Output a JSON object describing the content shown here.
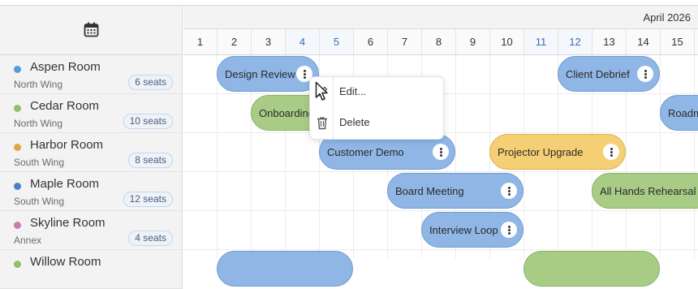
{
  "header": {
    "calendar_icon": "calendar-icon",
    "month": "April 2026",
    "days": [
      "1",
      "2",
      "3",
      "4",
      "5",
      "6",
      "7",
      "8",
      "9",
      "10",
      "11",
      "12",
      "13",
      "14",
      "15"
    ],
    "weekend_days": [
      "4",
      "5",
      "11",
      "12"
    ]
  },
  "resources": [
    {
      "name": "Aspen Room",
      "location": "North Wing",
      "seats": "6 seats",
      "color": "#5b9bd5"
    },
    {
      "name": "Cedar Room",
      "location": "North Wing",
      "seats": "10 seats",
      "color": "#8fc16a"
    },
    {
      "name": "Harbor Room",
      "location": "South Wing",
      "seats": "8 seats",
      "color": "#e0a544"
    },
    {
      "name": "Maple Room",
      "location": "South Wing",
      "seats": "12 seats",
      "color": "#4a82c4"
    },
    {
      "name": "Skyline Room",
      "location": "Annex",
      "seats": "4 seats",
      "color": "#c27fb0"
    },
    {
      "name": "Willow Room",
      "location": "",
      "seats": "",
      "color": "#8fc16a"
    }
  ],
  "events": [
    {
      "label": "Design Review",
      "color": "blue"
    },
    {
      "label": "Client Debrief",
      "color": "blue"
    },
    {
      "label": "Onboarding",
      "color": "green"
    },
    {
      "label": "Roadmap",
      "color": "blue"
    },
    {
      "label": "Customer Demo",
      "color": "blue"
    },
    {
      "label": "Projector Upgrade",
      "color": "yellow"
    },
    {
      "label": "Board Meeting",
      "color": "blue"
    },
    {
      "label": "All Hands Rehearsal",
      "color": "green"
    },
    {
      "label": "Interview Loop",
      "color": "blue"
    },
    {
      "label": "",
      "color": "blue"
    },
    {
      "label": "",
      "color": "green"
    }
  ],
  "context_menu": {
    "items": [
      {
        "label": "Edit...",
        "icon": "pencil-icon"
      },
      {
        "label": "Delete",
        "icon": "trash-icon"
      }
    ]
  }
}
